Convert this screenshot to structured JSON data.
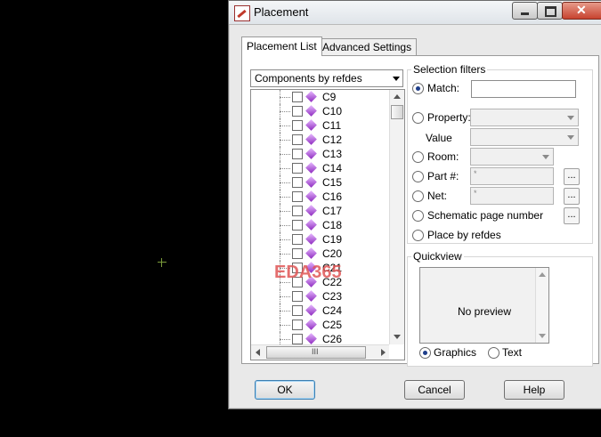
{
  "window": {
    "title": "Placement"
  },
  "tabs": [
    {
      "label": "Placement List",
      "active": true
    },
    {
      "label": "Advanced Settings",
      "active": false
    }
  ],
  "list": {
    "dropdown_value": "Components by refdes",
    "items": [
      "C9",
      "C10",
      "C11",
      "C12",
      "C13",
      "C14",
      "C15",
      "C16",
      "C17",
      "C18",
      "C19",
      "C20",
      "C21",
      "C22",
      "C23",
      "C24",
      "C25",
      "C26"
    ],
    "hscroll_grip": "III"
  },
  "filters": {
    "title": "Selection filters",
    "match_label": "Match:",
    "match_value": "",
    "property_label": "Property:",
    "value_label": "Value",
    "room_label": "Room:",
    "part_label": "Part #:",
    "part_value": "*",
    "net_label": "Net:",
    "net_value": "*",
    "schematic_label": "Schematic page number",
    "refdes_label": "Place by refdes",
    "ellipsis": "...",
    "selected": "match"
  },
  "quickview": {
    "title": "Quickview",
    "preview_text": "No preview",
    "graphics_label": "Graphics",
    "text_label": "Text",
    "selected": "graphics"
  },
  "watermark": "EDA365",
  "buttons": {
    "ok": "OK",
    "cancel": "Cancel",
    "help": "Help"
  },
  "colors": {
    "watermark": "#e05656",
    "close_button": "#c7432f",
    "gem": "#8e2bbf"
  }
}
